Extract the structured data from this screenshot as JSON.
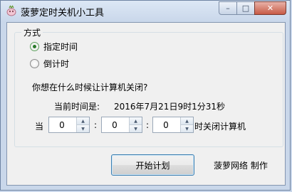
{
  "window": {
    "title": "菠萝定时关机小工具",
    "controls": {
      "minimize": "–",
      "maximize": "□",
      "close": "✕"
    }
  },
  "group": {
    "legend": "方式",
    "options": [
      {
        "label": "指定时间",
        "selected": true
      },
      {
        "label": "倒计时",
        "selected": false
      }
    ]
  },
  "question": "你想在什么时候让计算机关闭?",
  "current_time": {
    "label": "当前时间是:",
    "value": "2016年7月21日9时1分31秒"
  },
  "schedule": {
    "prefix": "当",
    "hours": "0",
    "minutes": "0",
    "seconds": "0",
    "separator": ":",
    "suffix": "时关闭计算机"
  },
  "actions": {
    "start_label": "开始计划"
  },
  "footer": {
    "credit": "菠萝网络  制作"
  }
}
